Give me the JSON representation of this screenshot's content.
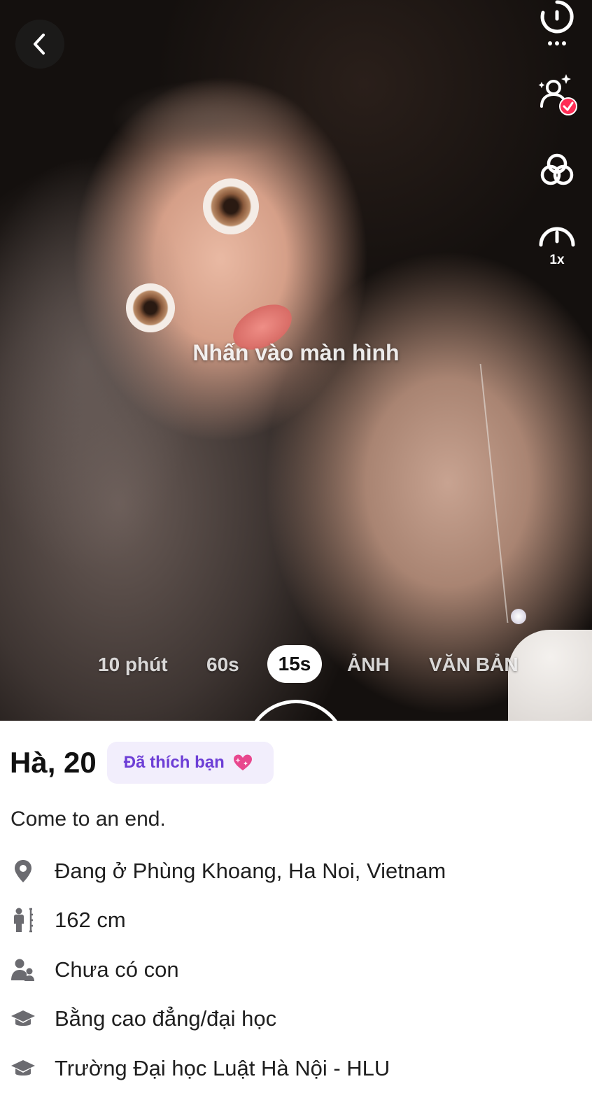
{
  "camera": {
    "hint_text": "Nhấn vào màn hình",
    "speed_label": "1x",
    "modes": [
      "10 phút",
      "60s",
      "15s",
      "ẢNH",
      "VĂN BẢN"
    ],
    "selected_mode": "15s"
  },
  "profile": {
    "name_age": "Hà, 20",
    "liked_badge": "Đã thích bạn",
    "bio": "Come to an end.",
    "info": [
      {
        "icon": "location-pin-icon",
        "text": "Đang ở Phùng Khoang, Ha Noi, Vietnam"
      },
      {
        "icon": "height-icon",
        "text": "162 cm"
      },
      {
        "icon": "children-icon",
        "text": "Chưa có con"
      },
      {
        "icon": "education-cap-icon",
        "text": "Bằng cao đẳng/đại học"
      },
      {
        "icon": "school-cap-icon",
        "text": "Trường Đại học Luật Hà Nội - HLU"
      }
    ]
  },
  "colors": {
    "badge_bg": "#f2eefc",
    "badge_text": "#6d3ed6",
    "verified_badge": "#ff2d55",
    "icon_gray": "#6b6b70"
  }
}
